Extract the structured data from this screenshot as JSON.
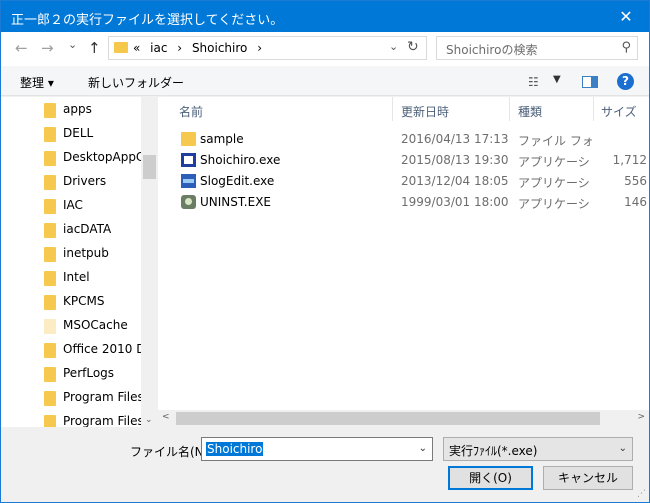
{
  "window": {
    "title": "正一郎２の実行ファイルを選択してください。",
    "close_glyph": "✕"
  },
  "nav": {
    "back_glyph": "←",
    "forward_glyph": "→",
    "recent_glyph": "⌄",
    "up_glyph": "↑",
    "breadcrumb": [
      "«",
      "iac",
      "›",
      "Shoichiro",
      "›"
    ],
    "address_dropdown_glyph": "⌄",
    "refresh_glyph": "↻",
    "search_placeholder": "Shoichiroの検索",
    "search_glyph": "⚲"
  },
  "toolbar": {
    "organize": "整理 ▾",
    "new_folder": "新しいフォルダー",
    "view_glyph": "☷",
    "view_dd": "▼",
    "help": "?"
  },
  "tree": {
    "items": [
      {
        "label": "apps"
      },
      {
        "label": "DELL"
      },
      {
        "label": "DesktopAppC"
      },
      {
        "label": "Drivers"
      },
      {
        "label": "IAC"
      },
      {
        "label": "iacDATA"
      },
      {
        "label": "inetpub"
      },
      {
        "label": "Intel"
      },
      {
        "label": "KPCMS"
      },
      {
        "label": "MSOCache"
      },
      {
        "label": "Office 2010 D"
      },
      {
        "label": "PerfLogs"
      },
      {
        "label": "Program Files"
      },
      {
        "label": "Program Files"
      }
    ],
    "scroll_down_glyph": "⌄"
  },
  "files": {
    "columns": {
      "name": "名前",
      "date": "更新日時",
      "type": "種類",
      "size": "サイズ"
    },
    "sort_caret": "^",
    "rows": [
      {
        "name": "sample",
        "date": "2016/04/13 17:13",
        "type": "ファイル フォルダー",
        "size": "",
        "icon": "folder-icon"
      },
      {
        "name": "Shoichiro.exe",
        "date": "2015/08/13 19:30",
        "type": "アプリケーション",
        "size": "1,712",
        "icon": "shoichiro-app-icon"
      },
      {
        "name": "SlogEdit.exe",
        "date": "2013/12/04 18:05",
        "type": "アプリケーション",
        "size": "556",
        "icon": "slogedit-app-icon"
      },
      {
        "name": "UNINST.EXE",
        "date": "1999/03/01 18:00",
        "type": "アプリケーション",
        "size": "146",
        "icon": "uninstall-app-icon"
      }
    ],
    "hscroll_left": "<",
    "hscroll_right": ">"
  },
  "bottom": {
    "filename_label": "ファイル名(N):",
    "filename_value": "Shoichiro",
    "filename_dd": "⌄",
    "filter_value": "実行ﾌｧｲﾙ(*.exe)",
    "filter_dd": "⌄",
    "open_button": "開く(O)",
    "cancel_button": "キャンセル",
    "grip": "⋰"
  }
}
